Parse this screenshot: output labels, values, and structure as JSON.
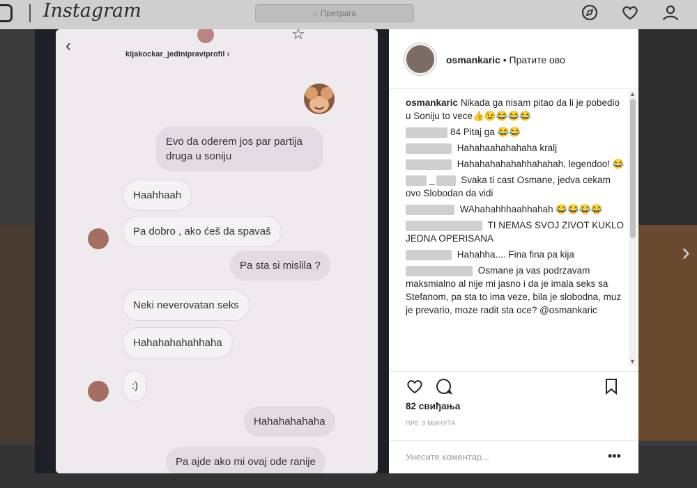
{
  "topbar": {
    "logo": "Instagram",
    "search_placeholder": "Претрага"
  },
  "chat": {
    "handle": "kijakockar_jedinipraviprofil",
    "messages": [
      {
        "side": "out",
        "text": "Evo da oderem jos par partija druga u soniju"
      },
      {
        "side": "in",
        "text": "Haahhaah"
      },
      {
        "side": "in",
        "text": "Pa dobro , ako ćeš da spavaš"
      },
      {
        "side": "out",
        "text": "Pa sta si mislila ?"
      },
      {
        "side": "in",
        "text": "Neki neverovatan seks"
      },
      {
        "side": "in",
        "text": "Hahahahahahhaha"
      },
      {
        "side": "in",
        "text": ":)"
      },
      {
        "side": "out",
        "text": "Hahahahahaha"
      },
      {
        "side": "out",
        "text": "Pa ajde ako mi ovaj ode ranije"
      }
    ]
  },
  "post": {
    "username": "osmankaric",
    "follow_text": "• Пратите ово",
    "caption_user": "osmankaric",
    "caption_text": "Nikada ga nisam pitao da li je pobedio u Soniju to vece👍😉😂😂😂",
    "comments": [
      {
        "user": "84",
        "text": "Pitaj ga 😂😂"
      },
      {
        "user": "",
        "text": "Hahahaahahahaha kralj"
      },
      {
        "user": "",
        "text": "Hahahahahahahhahahah, legendoo! 😂"
      },
      {
        "user": "_",
        "text": "Svaka ti cast Osmane, jedva cekam ovo Slobodan da vidi"
      },
      {
        "user": "",
        "text": "WAhahahhhaahhahah 😂😂😂😂"
      },
      {
        "user": "",
        "text": "TI NEMAS SVOJ ZIVOT KUKLO JEDNA OPERISANA"
      },
      {
        "user": "",
        "text": "Hahahha.... Fina fina pa kija"
      },
      {
        "user": "",
        "text": "Osmane ja vas podrzavam maksmialno al nije mi jasno i da je imala seks sa Stefanom, pa sta to ima veze, bila je slobodna, muz je prevario, moze radit sta oce? @osmankaric"
      }
    ],
    "likes": "82 свиђања",
    "time": "ПРЕ 3 МИНУТА",
    "add_comment_placeholder": "Унесите коментар..."
  },
  "colors": {
    "overlay": "#3a3a3a",
    "panel_bg": "#ffffff",
    "bubble_out": "#e2dce2",
    "bubble_in": "#f4f2f4"
  }
}
